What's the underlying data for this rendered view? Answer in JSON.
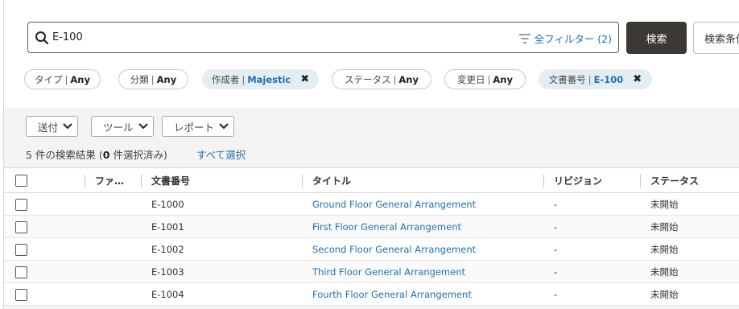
{
  "search": {
    "value": "E-100",
    "filter_link": "全フィルター (2)",
    "search_button": "検索",
    "advanced_button": "検索条件"
  },
  "chips": [
    {
      "label": "タイプ",
      "value": "Any",
      "active": false,
      "removable": false
    },
    {
      "label": "分類",
      "value": "Any",
      "active": false,
      "removable": false
    },
    {
      "label": "作成者",
      "value": "Majestic",
      "active": true,
      "removable": true
    },
    {
      "label": "ステータス",
      "value": "Any",
      "active": false,
      "removable": false
    },
    {
      "label": "変更日",
      "value": "Any",
      "active": false,
      "removable": false
    },
    {
      "label": "文書番号",
      "value": "E-100",
      "active": true,
      "removable": true
    }
  ],
  "toolbar": {
    "send": "送付",
    "tools": "ツール",
    "report": "レポート"
  },
  "results": {
    "count": "5",
    "prefix": " 件の検索結果 (",
    "selected": "0",
    "suffix": " 件選択済み)",
    "select_all": "すべて選択"
  },
  "table": {
    "headers": {
      "file": "ファ…",
      "doc_number": "文書番号",
      "title": "タイトル",
      "revision": "リビジョン",
      "status": "ステータス"
    },
    "rows": [
      {
        "doc_number": "E-1000",
        "title": "Ground Floor General Arrangement",
        "revision": "-",
        "status": "未開始"
      },
      {
        "doc_number": "E-1001",
        "title": "First Floor General Arrangement",
        "revision": "-",
        "status": "未開始"
      },
      {
        "doc_number": "E-1002",
        "title": "Second Floor General Arrangement",
        "revision": "-",
        "status": "未開始"
      },
      {
        "doc_number": "E-1003",
        "title": "Third Floor General Arrangement",
        "revision": "-",
        "status": "未開始"
      },
      {
        "doc_number": "E-1004",
        "title": "Fourth Floor General Arrangement",
        "revision": "-",
        "status": "未開始"
      }
    ]
  },
  "icons": {
    "search": "search-icon",
    "filter": "filter-lines-icon",
    "close": "close-icon",
    "chevron": "chevron-down-icon",
    "checkbox": "checkbox-icon"
  },
  "colors": {
    "accent": "#1f6fae",
    "primary_button": "#3c3834",
    "active_chip": "#e3eef2"
  }
}
